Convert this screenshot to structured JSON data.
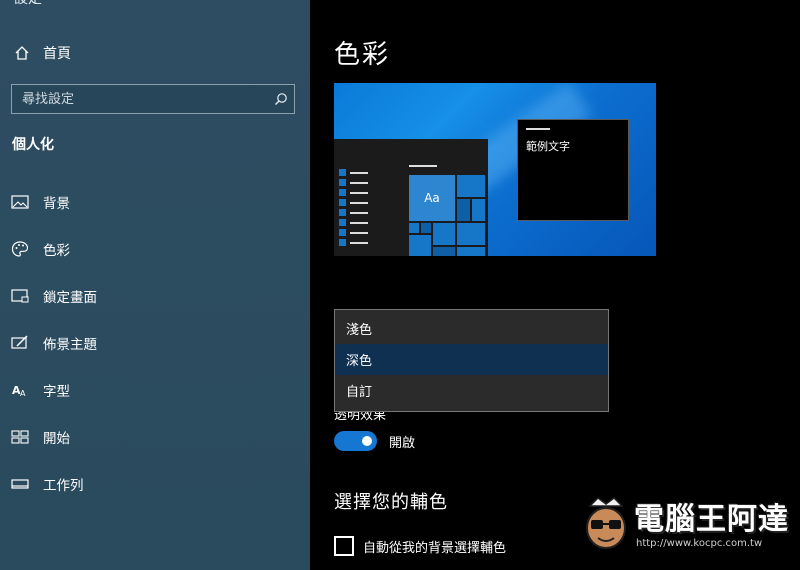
{
  "sidebar": {
    "clipped_title": "設定",
    "home": {
      "label": "首頁",
      "icon": "home-icon"
    },
    "search": {
      "placeholder": "尋找設定",
      "icon": "search-icon"
    },
    "section_title": "個人化",
    "items": [
      {
        "label": "背景",
        "icon": "picture-icon"
      },
      {
        "label": "色彩",
        "icon": "palette-icon"
      },
      {
        "label": "鎖定畫面",
        "icon": "lock-screen-icon"
      },
      {
        "label": "佈景主題",
        "icon": "theme-brush-icon"
      },
      {
        "label": "字型",
        "icon": "font-icon"
      },
      {
        "label": "開始",
        "icon": "start-tiles-icon"
      },
      {
        "label": "工作列",
        "icon": "taskbar-icon"
      }
    ]
  },
  "main": {
    "title": "色彩",
    "preview": {
      "tile_label": "Aa",
      "sample_text": "範例文字"
    },
    "mode_dropdown": {
      "options": [
        "淺色",
        "深色",
        "自訂"
      ],
      "selected": "深色"
    },
    "transparency": {
      "label": "透明效果",
      "toggle_state": "開啟",
      "on": true
    },
    "accent": {
      "title": "選擇您的輔色",
      "auto_checkbox_label": "自動從我的背景選擇輔色",
      "checked": false
    }
  },
  "watermark": {
    "text": "電腦王阿達",
    "url": "http://www.kocpc.com.tw"
  },
  "colors": {
    "sidebar_bg": "#2c4a5e",
    "main_bg": "#000000",
    "accent": "#1677d2",
    "dropdown_bg": "#2b2b2b",
    "dropdown_selected": "#0f3050"
  }
}
